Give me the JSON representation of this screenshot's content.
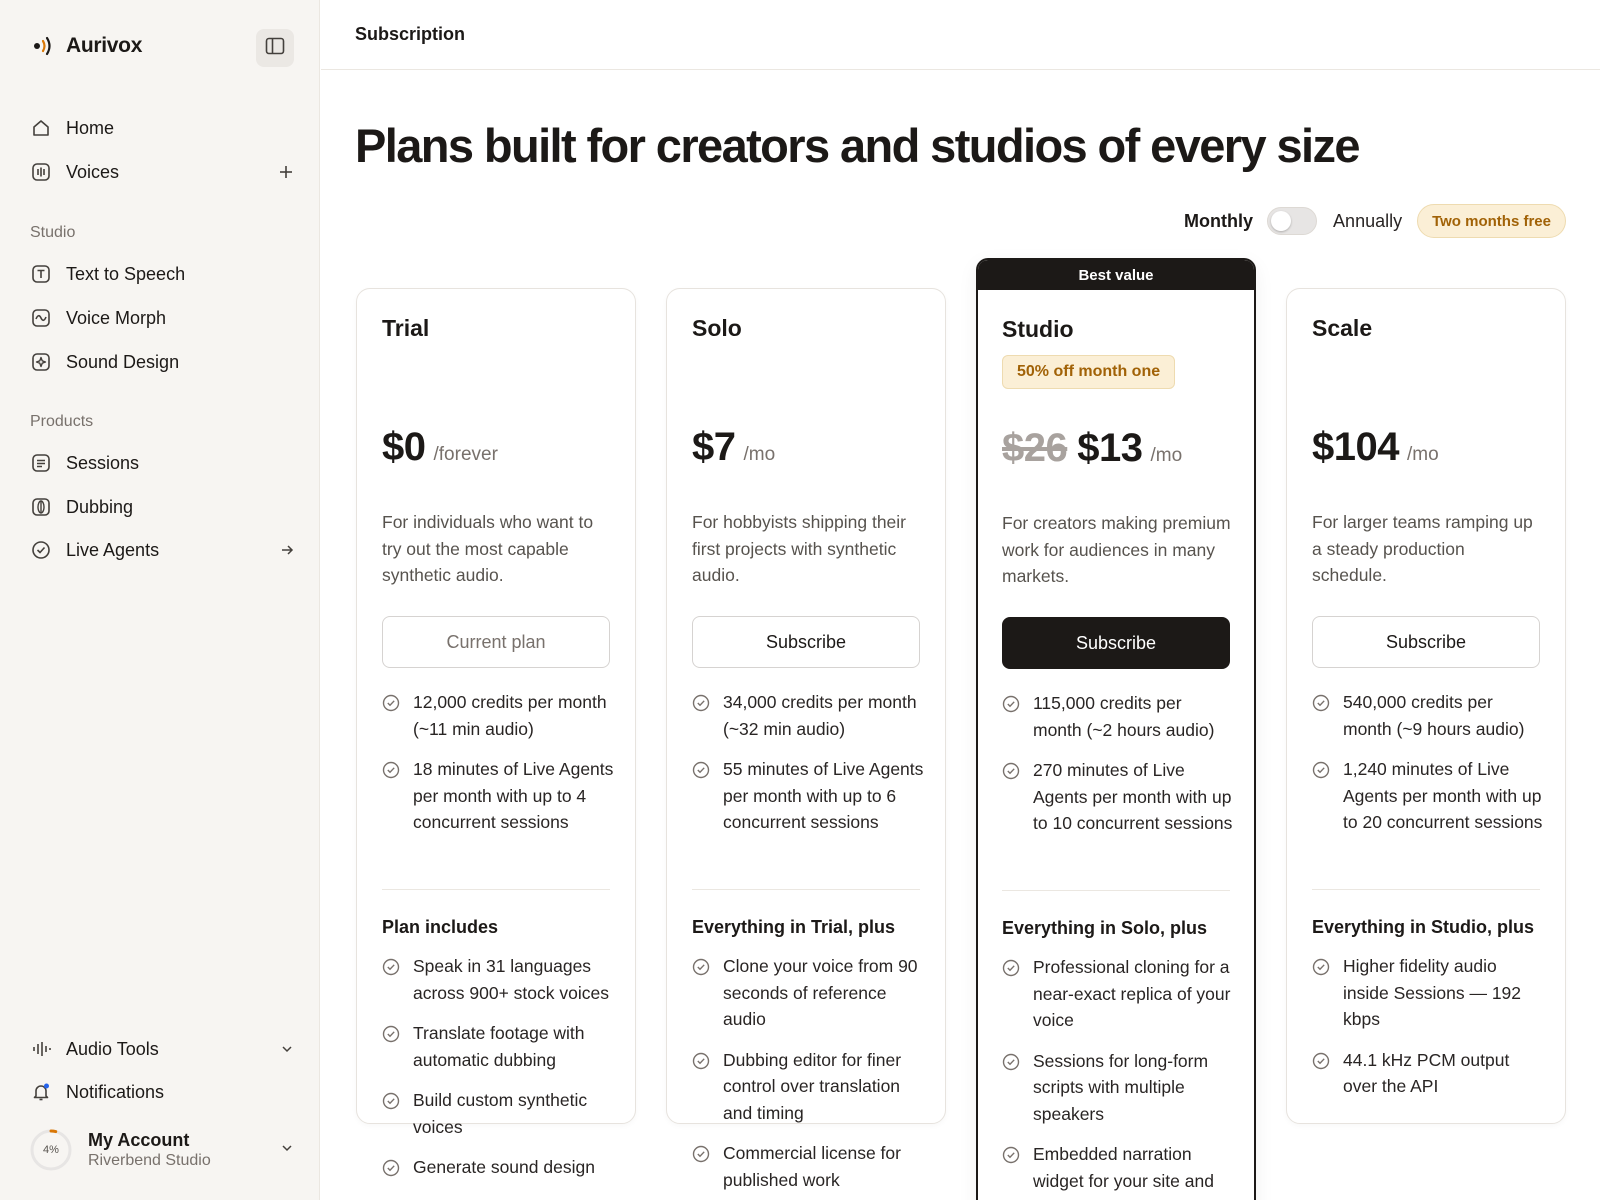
{
  "app": {
    "brand": "Aurivox",
    "page_title": "Subscription",
    "headline": "Plans built for creators and studios of every size"
  },
  "sidebar": {
    "top_items": [
      {
        "label": "Home",
        "icon": "home-icon"
      },
      {
        "label": "Voices",
        "icon": "voices-icon",
        "trail": "plus-icon"
      }
    ],
    "studio_label": "Studio",
    "studio_items": [
      {
        "label": "Text to Speech",
        "icon": "text-icon"
      },
      {
        "label": "Voice Morph",
        "icon": "waveform-icon"
      },
      {
        "label": "Sound Design",
        "icon": "sparkle-icon"
      }
    ],
    "products_label": "Products",
    "product_items": [
      {
        "label": "Sessions",
        "icon": "document-icon"
      },
      {
        "label": "Dubbing",
        "icon": "globe-icon"
      },
      {
        "label": "Live Agents",
        "icon": "check-circle-icon",
        "trail": "arrow-right-icon"
      }
    ],
    "bottom_items": [
      {
        "label": "Audio Tools",
        "icon": "audio-bars-icon",
        "trail": "chevron-down-icon"
      },
      {
        "label": "Notifications",
        "icon": "bell-icon"
      }
    ],
    "account": {
      "name": "My Account",
      "org": "Riverbend Studio",
      "usage_label": "4%",
      "usage_fraction": 0.04
    }
  },
  "billing": {
    "monthly_label": "Monthly",
    "annual_label": "Annually",
    "promo": "Two months free",
    "annual_selected": false
  },
  "plans": [
    {
      "name": "Trial",
      "price": "$0",
      "period": "/forever",
      "description": "For individuals who want to try out the most capable synthetic audio.",
      "cta": "Current plan",
      "features": [
        "12,000 credits per month (~11 min audio)",
        "18 minutes of Live Agents per month with up to 4 concurrent sessions"
      ],
      "includes_title": "Plan includes",
      "includes": [
        "Speak in 31 languages across 900+ stock voices",
        "Translate footage with automatic dubbing",
        "Build custom synthetic voices",
        "Generate sound design"
      ]
    },
    {
      "name": "Solo",
      "price": "$7",
      "period": "/mo",
      "description": "For hobbyists shipping their first projects with synthetic audio.",
      "cta": "Subscribe",
      "features": [
        "34,000 credits per month (~32 min audio)",
        "55 minutes of Live Agents per month with up to 6 concurrent sessions"
      ],
      "includes_title": "Everything in Trial, plus",
      "includes": [
        "Clone your voice from 90 seconds of reference audio",
        "Dubbing editor for finer control over translation and timing",
        "Commercial license for published work"
      ]
    },
    {
      "name": "Studio",
      "badge": "Best value",
      "tag": "50% off month one",
      "price_old": "$26",
      "price": "$13",
      "period": "/mo",
      "description": "For creators making premium work for audiences in many markets.",
      "cta": "Subscribe",
      "features": [
        "115,000 credits per month (~2 hours audio)",
        "270 minutes of Live Agents per month with up to 10 concurrent sessions"
      ],
      "includes_title": "Everything in Solo, plus",
      "includes": [
        "Professional cloning for a near-exact replica of your voice",
        "Sessions for long-form scripts with multiple speakers",
        "Embedded narration widget for your site and blog"
      ]
    },
    {
      "name": "Scale",
      "price": "$104",
      "period": "/mo",
      "description": "For larger teams ramping up a steady production schedule.",
      "cta": "Subscribe",
      "features": [
        "540,000 credits per month (~9 hours audio)",
        "1,240 minutes of Live Agents per month with up to 20 concurrent sessions"
      ],
      "includes_title": "Everything in Studio, plus",
      "includes": [
        "Higher fidelity audio inside Sessions — 192 kbps",
        "44.1 kHz PCM output over the API"
      ]
    }
  ],
  "colors": {
    "accent_dark": "#1c1917",
    "promo_bg": "#fbefd6",
    "promo_text": "#a16207",
    "notification_dot": "#2563eb",
    "logo_accent": "#d97706"
  }
}
